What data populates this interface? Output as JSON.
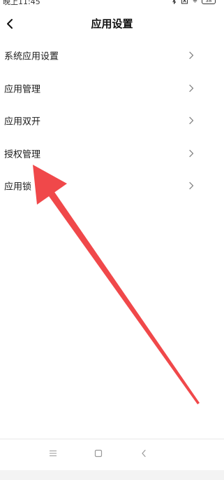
{
  "status_bar": {
    "time": "晚上11:45",
    "battery": "38"
  },
  "header": {
    "title": "应用设置",
    "back_icon": "chevron-left-icon"
  },
  "menu": {
    "items": [
      {
        "label": "系统应用设置"
      },
      {
        "label": "应用管理"
      },
      {
        "label": "应用双开"
      },
      {
        "label": "授权管理"
      },
      {
        "label": "应用锁"
      }
    ],
    "chevron_icon": "chevron-right-icon"
  },
  "annotation": {
    "color": "#f0484a",
    "icon": "red-arrow-pointing-to-authorization"
  },
  "nav_bar": {
    "icons": [
      "menu-icon",
      "home-icon",
      "back-icon"
    ]
  }
}
